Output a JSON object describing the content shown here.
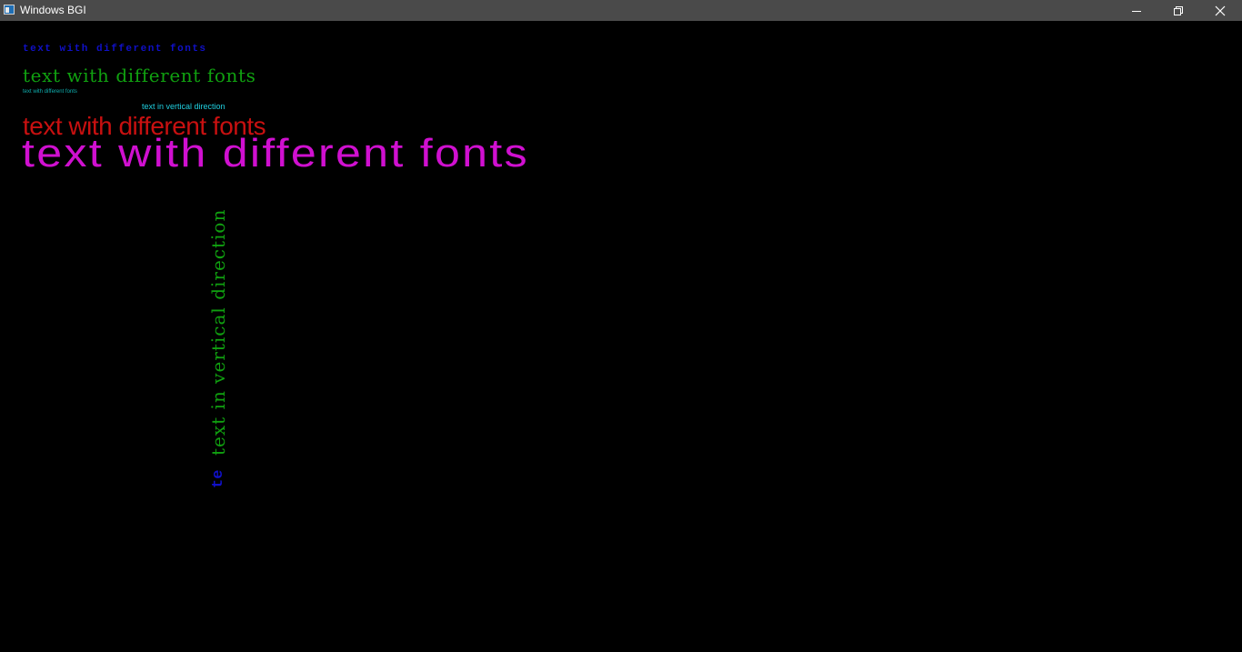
{
  "window": {
    "title": "Windows BGI",
    "icon": "bgi-window-icon",
    "controls": [
      "minimize-icon",
      "restore-icon",
      "close-icon"
    ]
  },
  "canvas": {
    "background": "#000000",
    "texts": {
      "line1": "text with different fonts",
      "line2": "text with different fonts",
      "line3": "text with different fonts",
      "vertical_small": "text in vertical direction",
      "line4": "text with different fonts",
      "line5": "text with different fonts",
      "vertical_green": "text in vertical direction",
      "vertical_blue": "te"
    },
    "colors": {
      "blue": "#1010c8",
      "green": "#10a010",
      "cyan": "#20d0e0",
      "red": "#c81010",
      "magenta": "#d010d0"
    }
  }
}
